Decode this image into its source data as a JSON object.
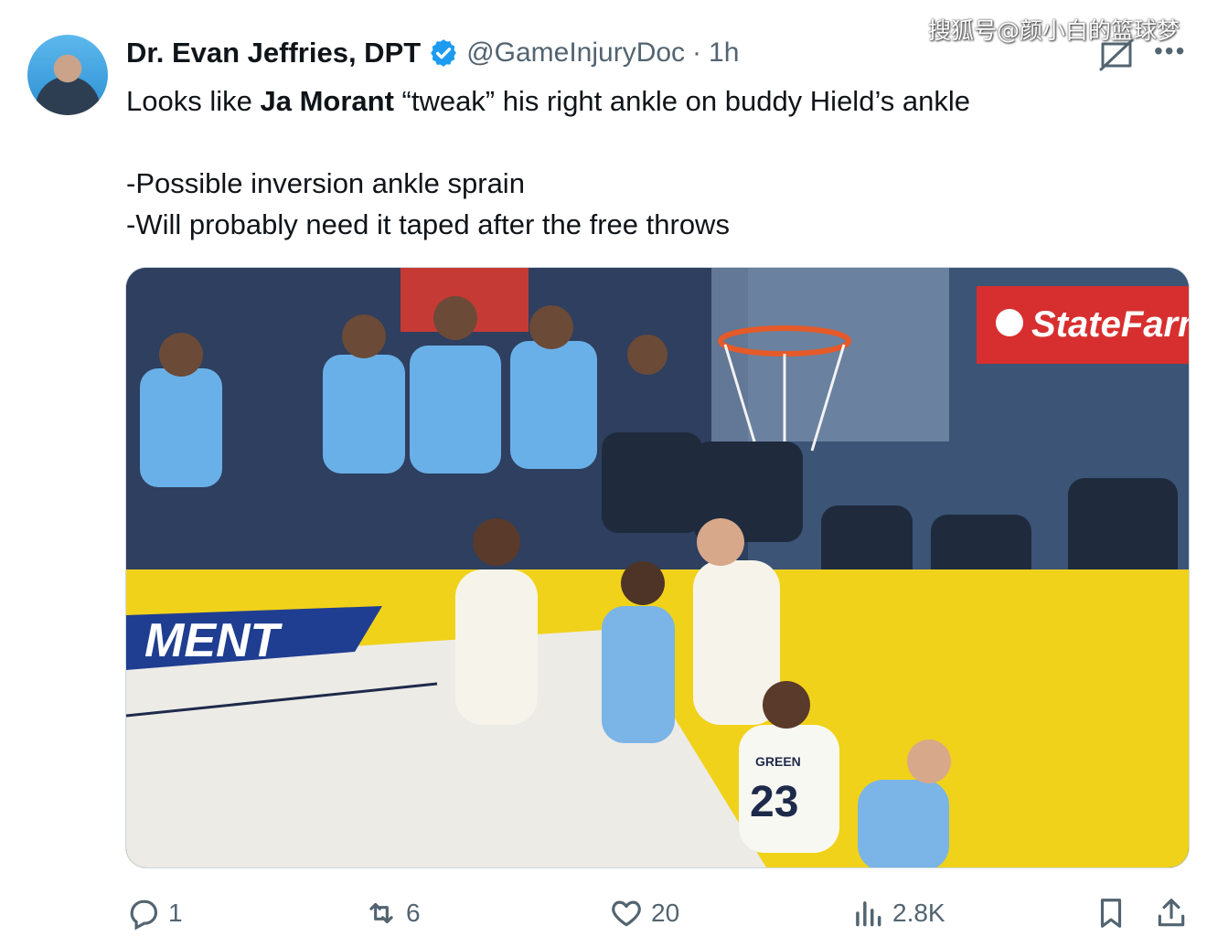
{
  "watermark": "搜狐号@颜小白的篮球梦",
  "author": {
    "name": "Dr. Evan Jeffries, DPT",
    "handle": "@GameInjuryDoc",
    "separator": "·",
    "time": "1h"
  },
  "tweet": {
    "line1_prefix": "Looks like ",
    "line1_bold": "Ja Morant",
    "line1_suffix": " “tweak” his right ankle on buddy Hield’s ankle",
    "line2": "-Possible inversion ankle sprain",
    "line3": "-Will probably need it taped after the free throws"
  },
  "media": {
    "sponsor": "StateFarm",
    "court_text": "MENT",
    "jersey_name": "GREEN",
    "jersey_number": "23"
  },
  "actions": {
    "replies": "1",
    "reposts": "6",
    "likes": "20",
    "views": "2.8K"
  },
  "icons": [
    "verified-badge-icon",
    "grok-icon",
    "more-icon",
    "reply-icon",
    "repost-icon",
    "like-icon",
    "views-icon",
    "bookmark-icon",
    "share-icon"
  ],
  "colors": {
    "accent": "#1d9bf0",
    "secondary_text": "#536471"
  }
}
